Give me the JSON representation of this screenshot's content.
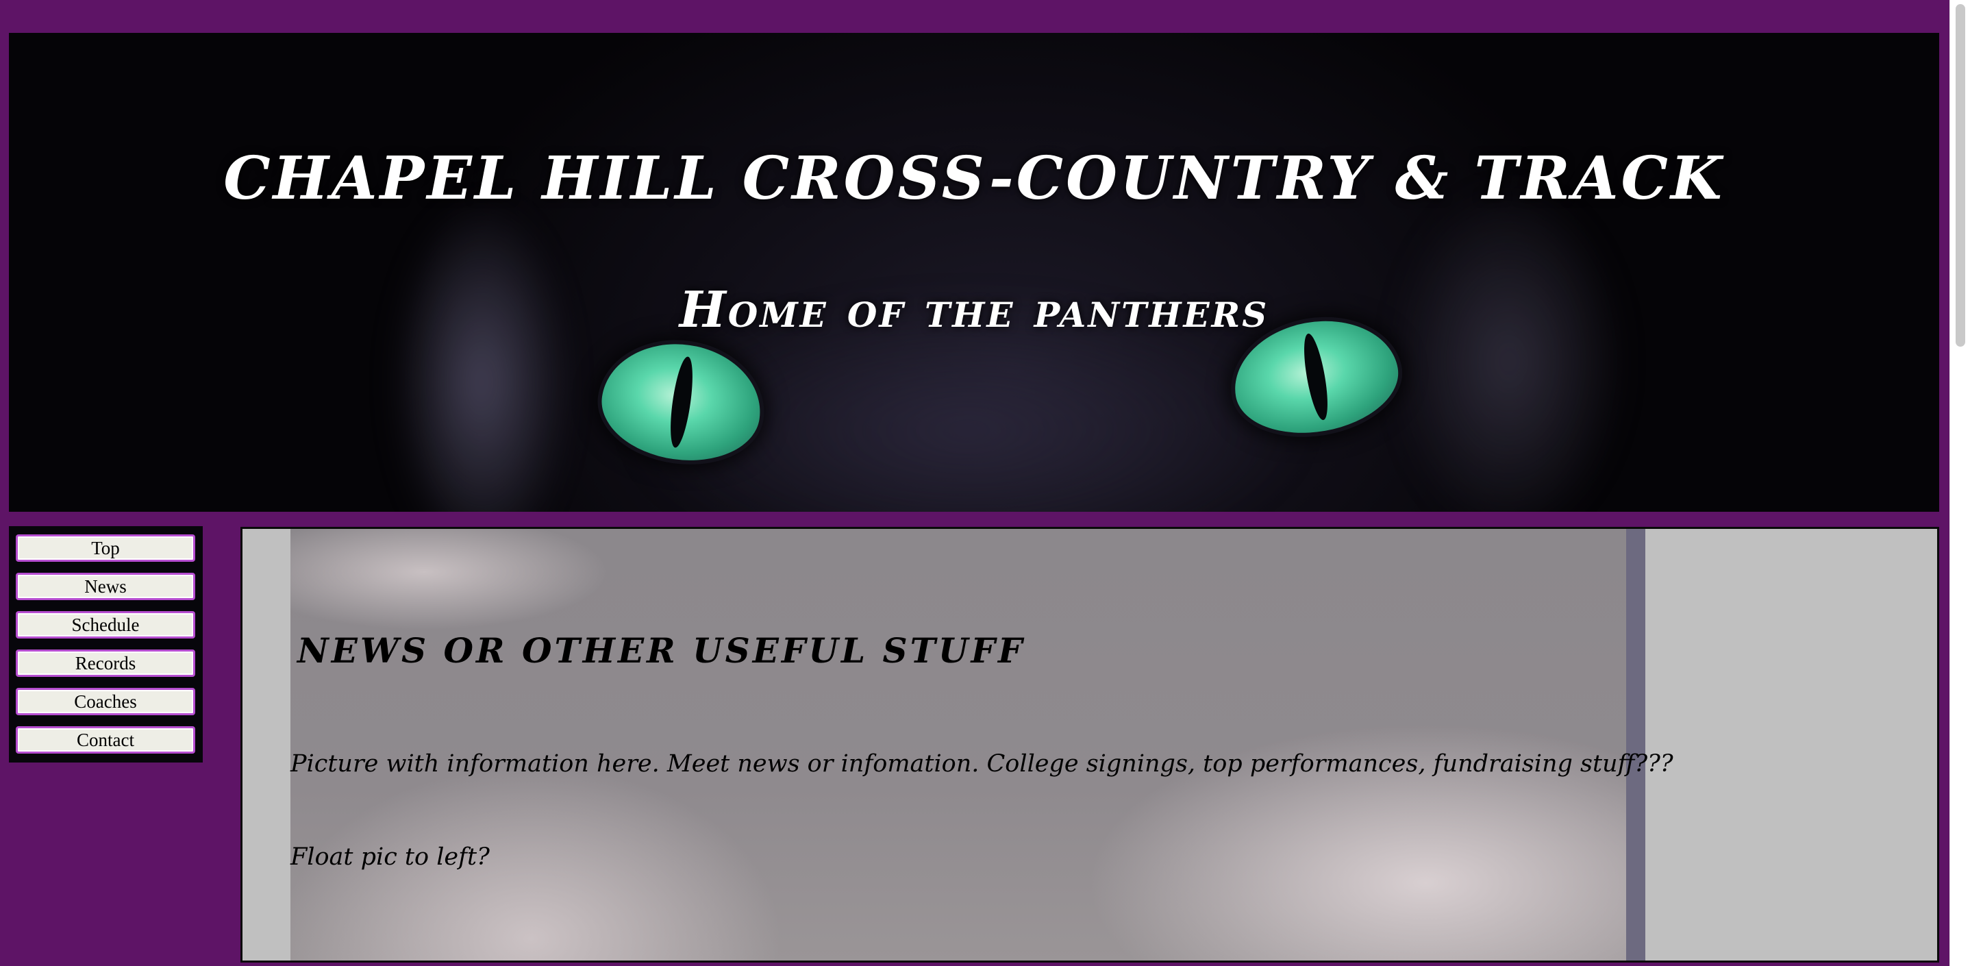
{
  "header": {
    "title": "CHAPEL HILL CROSS-COUNTRY & TRACK",
    "subtitle": "Home of the panthers"
  },
  "nav": {
    "items": [
      {
        "label": "Top"
      },
      {
        "label": "News"
      },
      {
        "label": "Schedule"
      },
      {
        "label": "Records"
      },
      {
        "label": "Coaches"
      },
      {
        "label": "Contact"
      }
    ]
  },
  "main": {
    "heading": "NEWS OR OTHER USEFUL STUFF",
    "paragraphs": [
      "Picture with information here. Meet news or infomation. College signings, top performances, fundraising stuff???",
      "Float pic to left?"
    ]
  },
  "colors": {
    "page_background": "#5e1466",
    "nav_button_border": "#b64dd0",
    "eye_green": "#5ad7ab"
  }
}
